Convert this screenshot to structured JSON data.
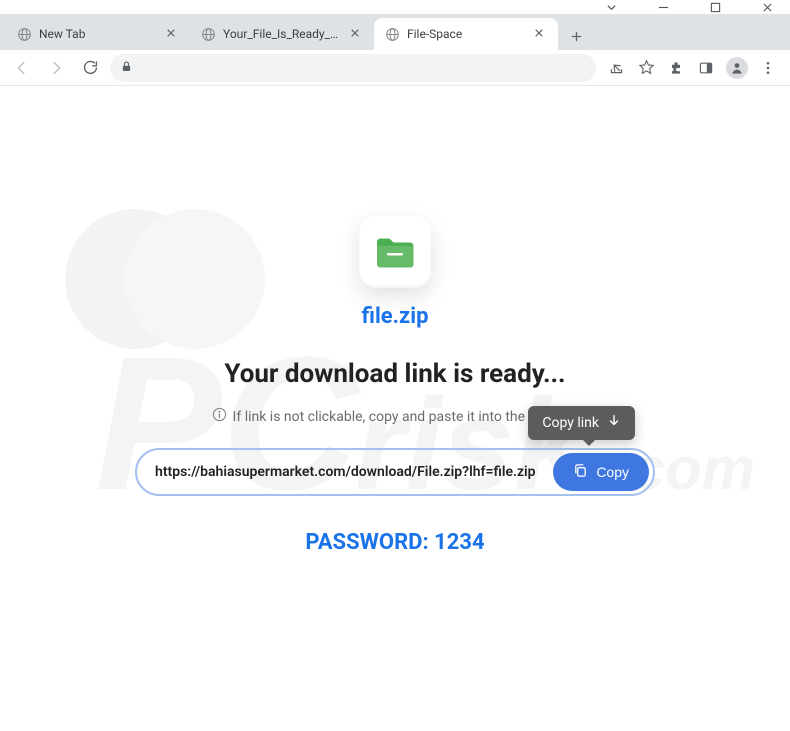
{
  "window": {
    "controls": [
      "minimize",
      "maximize",
      "close"
    ]
  },
  "tabs": [
    {
      "title": "New Tab",
      "active": false
    },
    {
      "title": "Your_File_Is_Ready_To_Downl",
      "active": false
    },
    {
      "title": "File-Space",
      "active": true
    }
  ],
  "page": {
    "file_name": "file.zip",
    "headline": "Your download link is ready...",
    "hint": "If link is not clickable, copy and paste it into the address",
    "download_url": "https://bahiasupermarket.com/download/File.zip?lhf=file.zip",
    "copy_button": "Copy",
    "tooltip": "Copy link",
    "password_label": "PASSWORD: 1234"
  },
  "watermark": "PCrisk.com"
}
